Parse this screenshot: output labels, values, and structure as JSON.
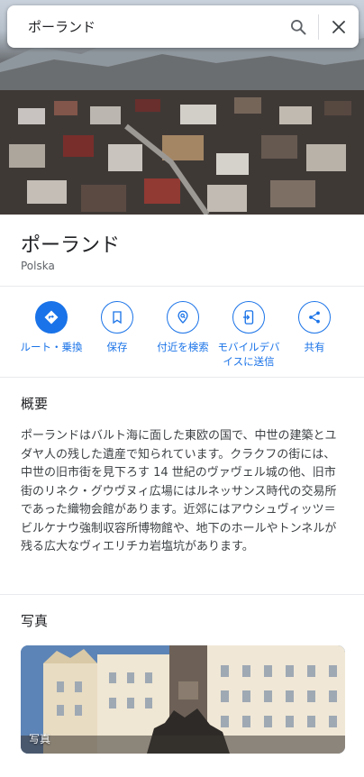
{
  "search": {
    "value": "ポーランド"
  },
  "place": {
    "title": "ポーランド",
    "subtitle": "Polska"
  },
  "actions": [
    {
      "label": "ルート・乗換",
      "icon": "directions-icon"
    },
    {
      "label": "保存",
      "icon": "bookmark-icon"
    },
    {
      "label": "付近を検索",
      "icon": "nearby-search-icon"
    },
    {
      "label": "モバイルデバイスに送信",
      "icon": "send-to-phone-icon"
    },
    {
      "label": "共有",
      "icon": "share-icon"
    }
  ],
  "overview": {
    "title": "概要",
    "text": "ポーランドはバルト海に面した東欧の国で、中世の建築とユダヤ人の残した遺産で知られています。クラクフの街には、中世の旧市街を見下ろす 14 世紀のヴァヴェル城の他、旧市街のリネク・グウヴヌィ広場にはルネッサンス時代の交易所であった織物会館があります。近郊にはアウシュヴィッツ＝ビルケナウ強制収容所博物館や、地下のホールやトンネルが残る広大なヴィエリチカ岩塩坑があります。"
  },
  "photos": {
    "title": "写真",
    "card_label": "写真"
  },
  "colors": {
    "accent": "#1a73e8",
    "text": "#202124",
    "divider": "#e8eaed"
  }
}
